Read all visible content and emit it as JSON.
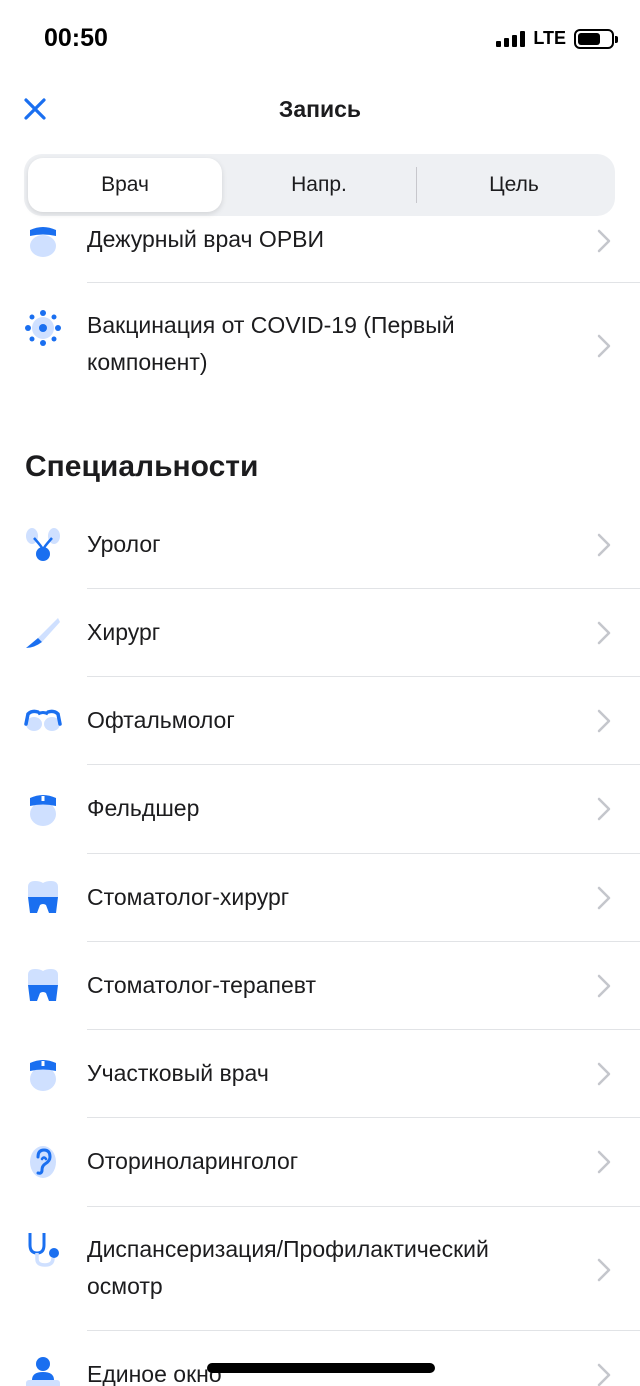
{
  "status": {
    "time": "00:50",
    "network": "LTE"
  },
  "nav": {
    "title": "Запись"
  },
  "tabs": [
    {
      "label": "Врач",
      "active": true
    },
    {
      "label": "Напр.",
      "active": false
    },
    {
      "label": "Цель",
      "active": false
    }
  ],
  "top_items": [
    {
      "label": "Дежурный врач ОРВИ",
      "icon": "doctor-cap-icon"
    },
    {
      "label": "Вакцинация от COVID-19 (Первый компонент)",
      "icon": "virus-icon"
    }
  ],
  "section": {
    "title": "Специальности"
  },
  "specialties": [
    {
      "label": "Уролог",
      "icon": "kidneys-icon"
    },
    {
      "label": "Хирург",
      "icon": "scalpel-icon"
    },
    {
      "label": "Офтальмолог",
      "icon": "glasses-icon"
    },
    {
      "label": "Фельдшер",
      "icon": "doctor-cap-icon"
    },
    {
      "label": "Стоматолог-хирург",
      "icon": "tooth-icon"
    },
    {
      "label": "Стоматолог-терапевт",
      "icon": "tooth-icon"
    },
    {
      "label": "Участковый врач",
      "icon": "doctor-cap-icon"
    },
    {
      "label": "Оториноларинголог",
      "icon": "ear-icon"
    },
    {
      "label": "Диспансеризация/Профилактический осмотр",
      "icon": "stethoscope-icon"
    },
    {
      "label": "Единое окно",
      "icon": "person-desk-icon"
    }
  ],
  "colors": {
    "accent": "#1a6ff0",
    "accent_light": "#cfe0ff",
    "chevron": "#c4c6cc"
  }
}
